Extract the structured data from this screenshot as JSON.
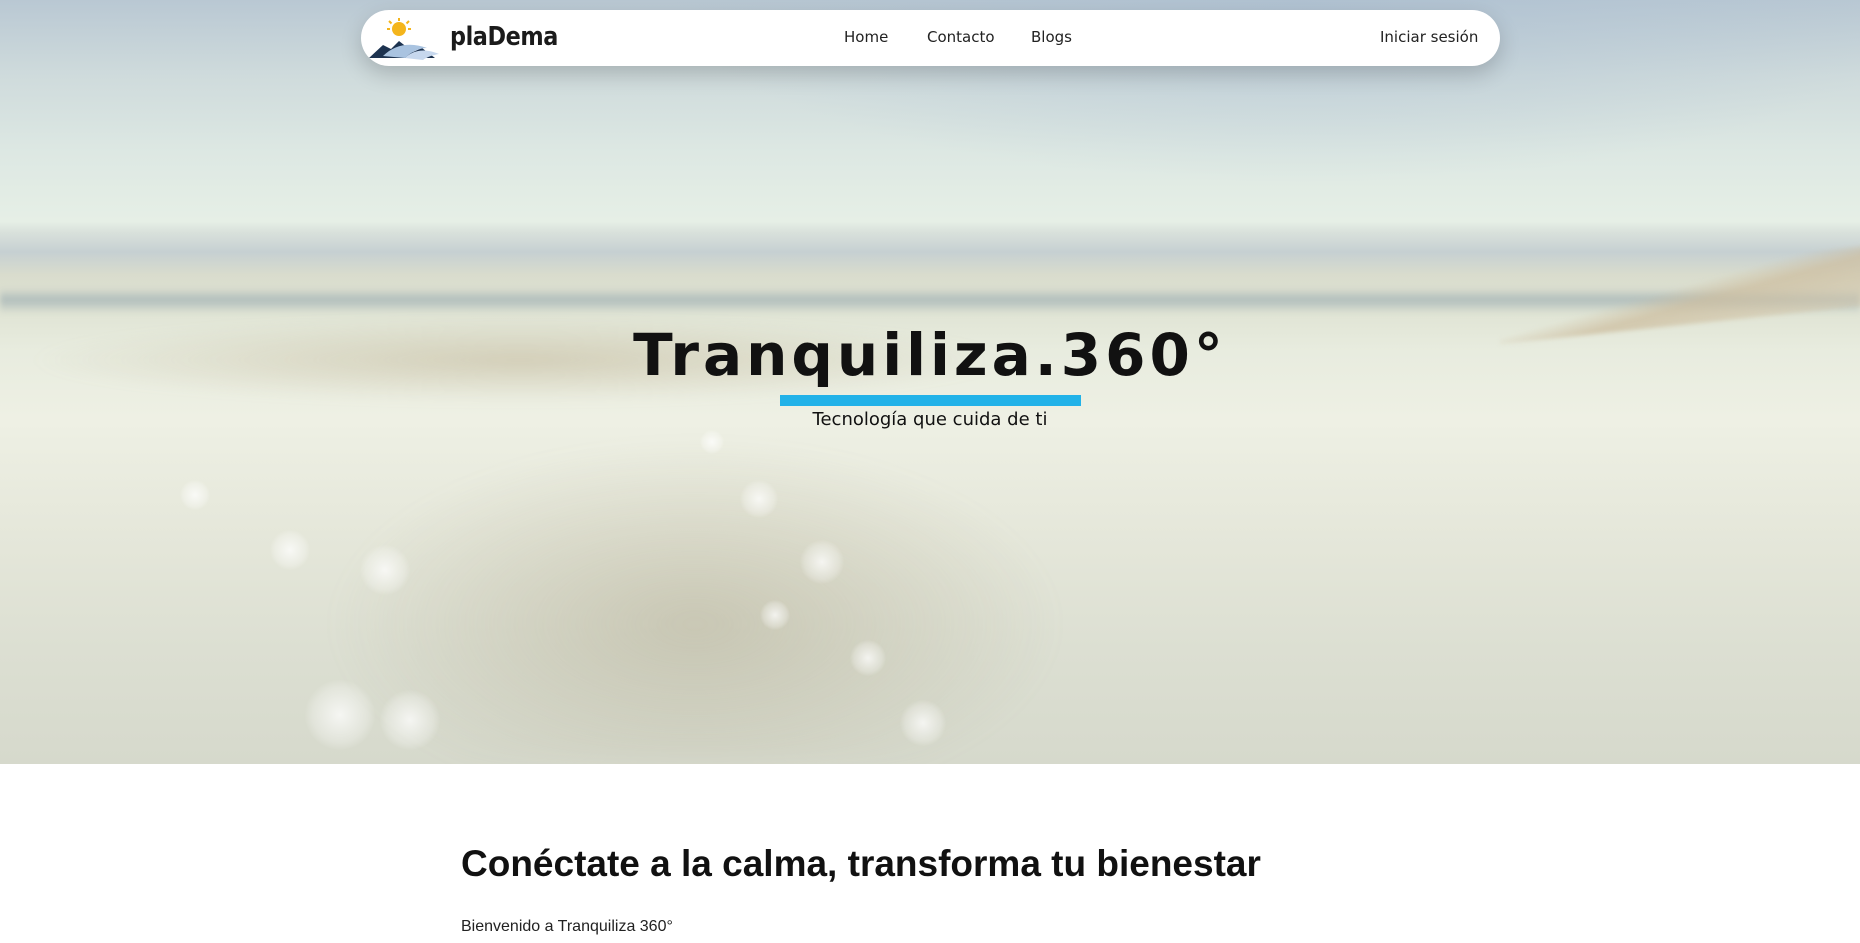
{
  "navbar": {
    "logo_text": "plaDema",
    "links": {
      "home": "Home",
      "contacto": "Contacto",
      "blogs": "Blogs"
    },
    "login_label": "Iniciar sesión"
  },
  "hero": {
    "title": "Tranquiliza.360°",
    "subtitle": "Tecnología que cuida de ti",
    "accent_color": "#22b2e8"
  },
  "content": {
    "heading": "Conéctate a la calma, transforma tu bienestar",
    "intro": "Bienvenido a Tranquiliza 360°"
  },
  "icons": {
    "logo": "sun-over-mountain-wave-logo"
  }
}
